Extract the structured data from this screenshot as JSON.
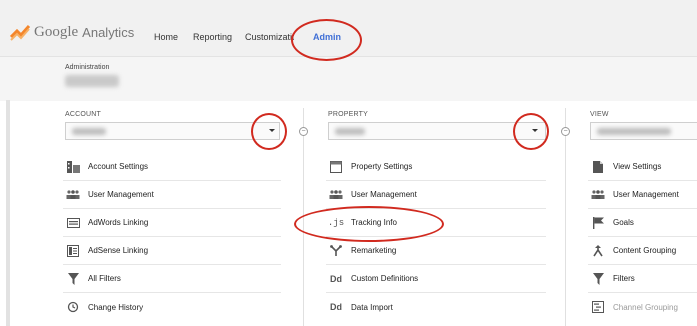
{
  "brand": {
    "google": "Google",
    "analytics": "Analytics"
  },
  "nav": [
    {
      "label": "Home"
    },
    {
      "label": "Reporting"
    },
    {
      "label": "Customization"
    },
    {
      "label": "Admin",
      "active": true
    }
  ],
  "administration": {
    "label": "Administration"
  },
  "columns": [
    {
      "title": "ACCOUNT",
      "items": [
        {
          "label": "Account Settings",
          "icon": "building-icon"
        },
        {
          "label": "User Management",
          "icon": "users-icon"
        },
        {
          "label": "AdWords Linking",
          "icon": "adwords-icon"
        },
        {
          "label": "AdSense Linking",
          "icon": "adsense-icon"
        },
        {
          "label": "All Filters",
          "icon": "filter-icon"
        },
        {
          "label": "Change History",
          "icon": "history-icon"
        }
      ]
    },
    {
      "title": "PROPERTY",
      "items": [
        {
          "label": "Property Settings",
          "icon": "property-settings-icon"
        },
        {
          "label": "User Management",
          "icon": "users-icon"
        },
        {
          "label": "Tracking Info",
          "icon": "js-icon"
        },
        {
          "label": "Remarketing",
          "icon": "remarketing-icon"
        },
        {
          "label": "Custom Definitions",
          "icon": "custom-definitions-icon"
        },
        {
          "label": "Data Import",
          "icon": "data-import-icon"
        }
      ]
    },
    {
      "title": "VIEW",
      "items": [
        {
          "label": "View Settings",
          "icon": "document-icon"
        },
        {
          "label": "User Management",
          "icon": "users-icon"
        },
        {
          "label": "Goals",
          "icon": "flag-icon"
        },
        {
          "label": "Content Grouping",
          "icon": "content-grouping-icon"
        },
        {
          "label": "Filters",
          "icon": "filter-icon"
        },
        {
          "label": "Channel Grouping",
          "icon": "channel-grouping-icon"
        }
      ]
    }
  ],
  "colors": {
    "accent": "#3f6fd6",
    "highlight_ring": "#d12a1f",
    "logo_orange": "#f4862b"
  }
}
